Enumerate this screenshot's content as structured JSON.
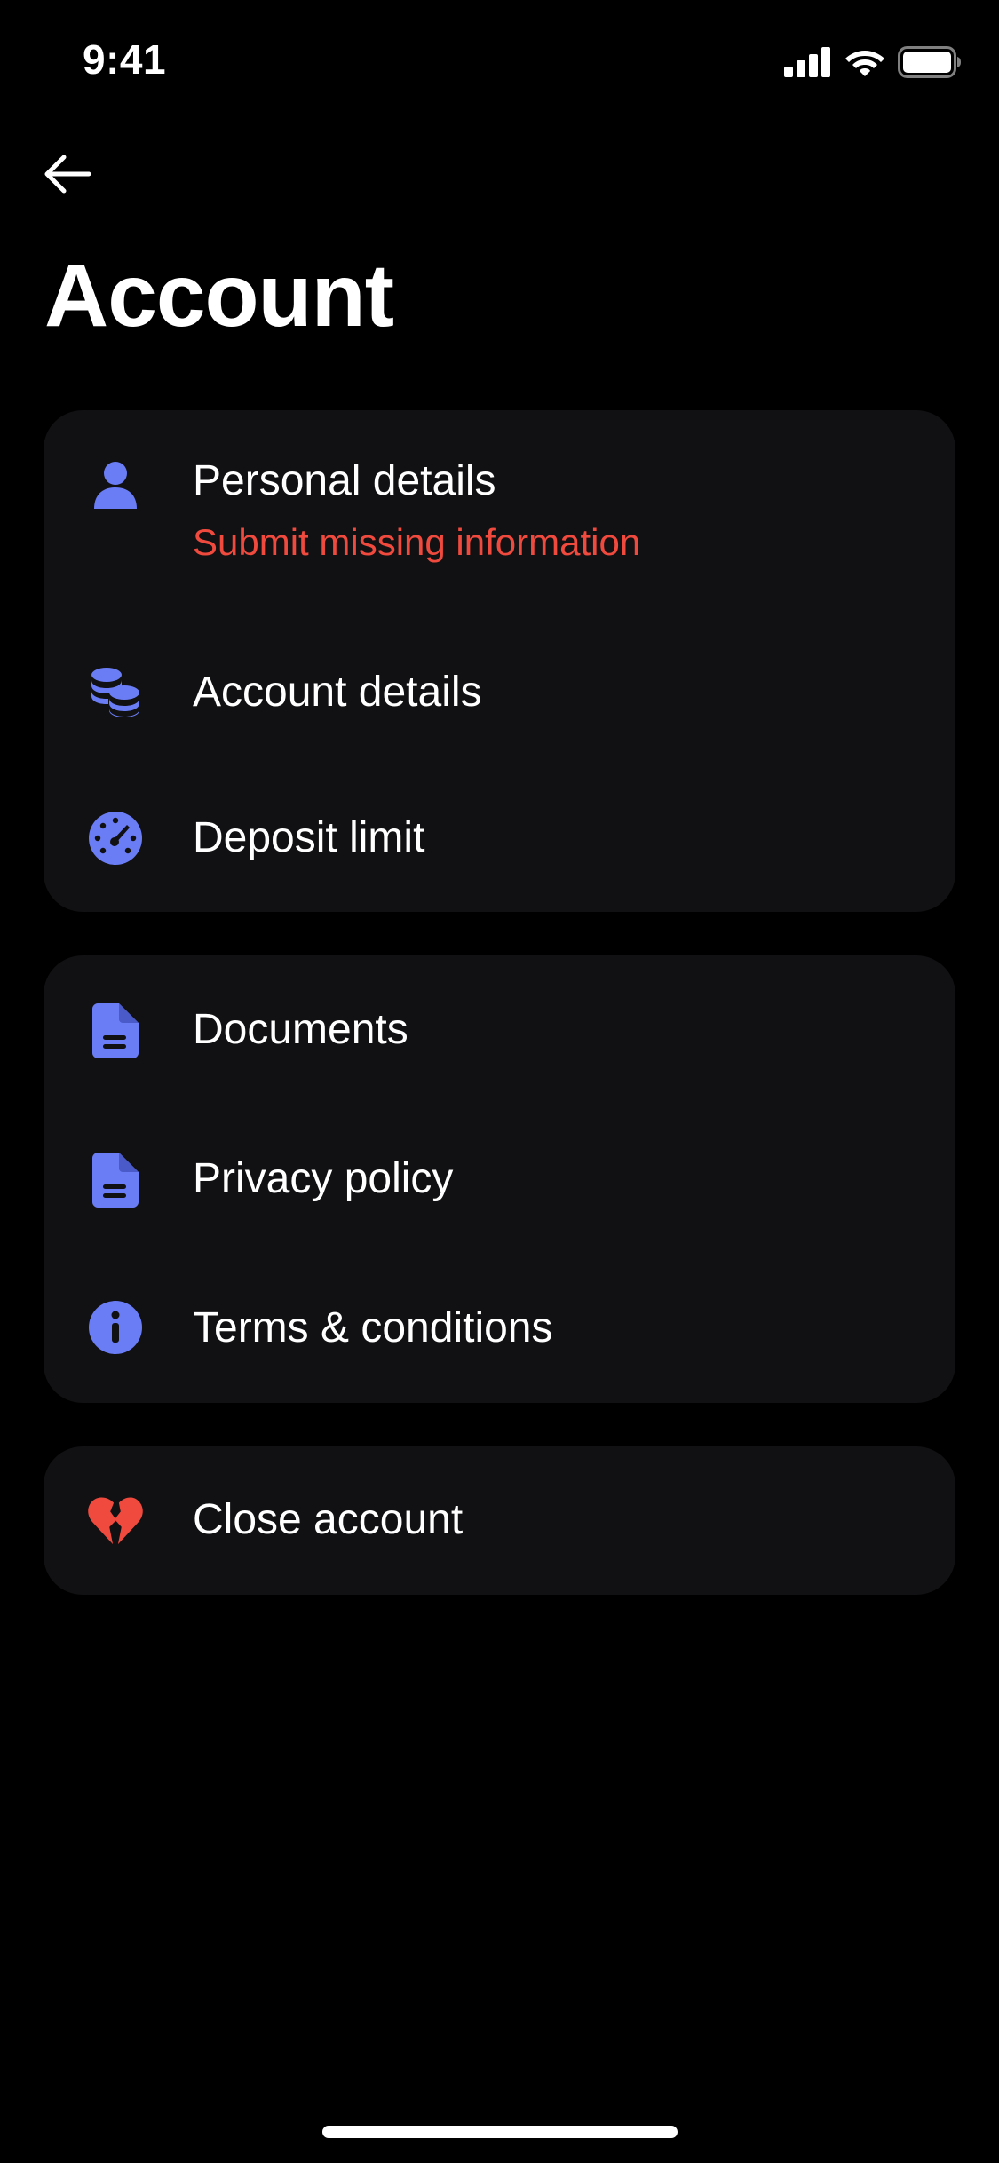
{
  "status_bar": {
    "time": "9:41",
    "icons": [
      "cellular-signal-icon",
      "wifi-icon",
      "battery-icon"
    ]
  },
  "header": {
    "back_icon": "arrow-left-icon",
    "title": "Account"
  },
  "colors": {
    "background": "#000000",
    "card": "#111113",
    "accent": "#6A7DF5",
    "warning": "#F04A3E",
    "text": "#FFFFFF"
  },
  "sections": [
    {
      "items": [
        {
          "label": "Personal details",
          "sublabel": "Submit missing information",
          "icon": "person-icon"
        },
        {
          "label": "Account details",
          "icon": "coins-icon"
        },
        {
          "label": "Deposit limit",
          "icon": "speedometer-icon"
        }
      ]
    },
    {
      "items": [
        {
          "label": "Documents",
          "icon": "document-icon"
        },
        {
          "label": "Privacy policy",
          "icon": "document-icon"
        },
        {
          "label": "Terms & conditions",
          "icon": "info-icon"
        }
      ]
    },
    {
      "items": [
        {
          "label": "Close account",
          "icon": "broken-heart-icon"
        }
      ]
    }
  ]
}
